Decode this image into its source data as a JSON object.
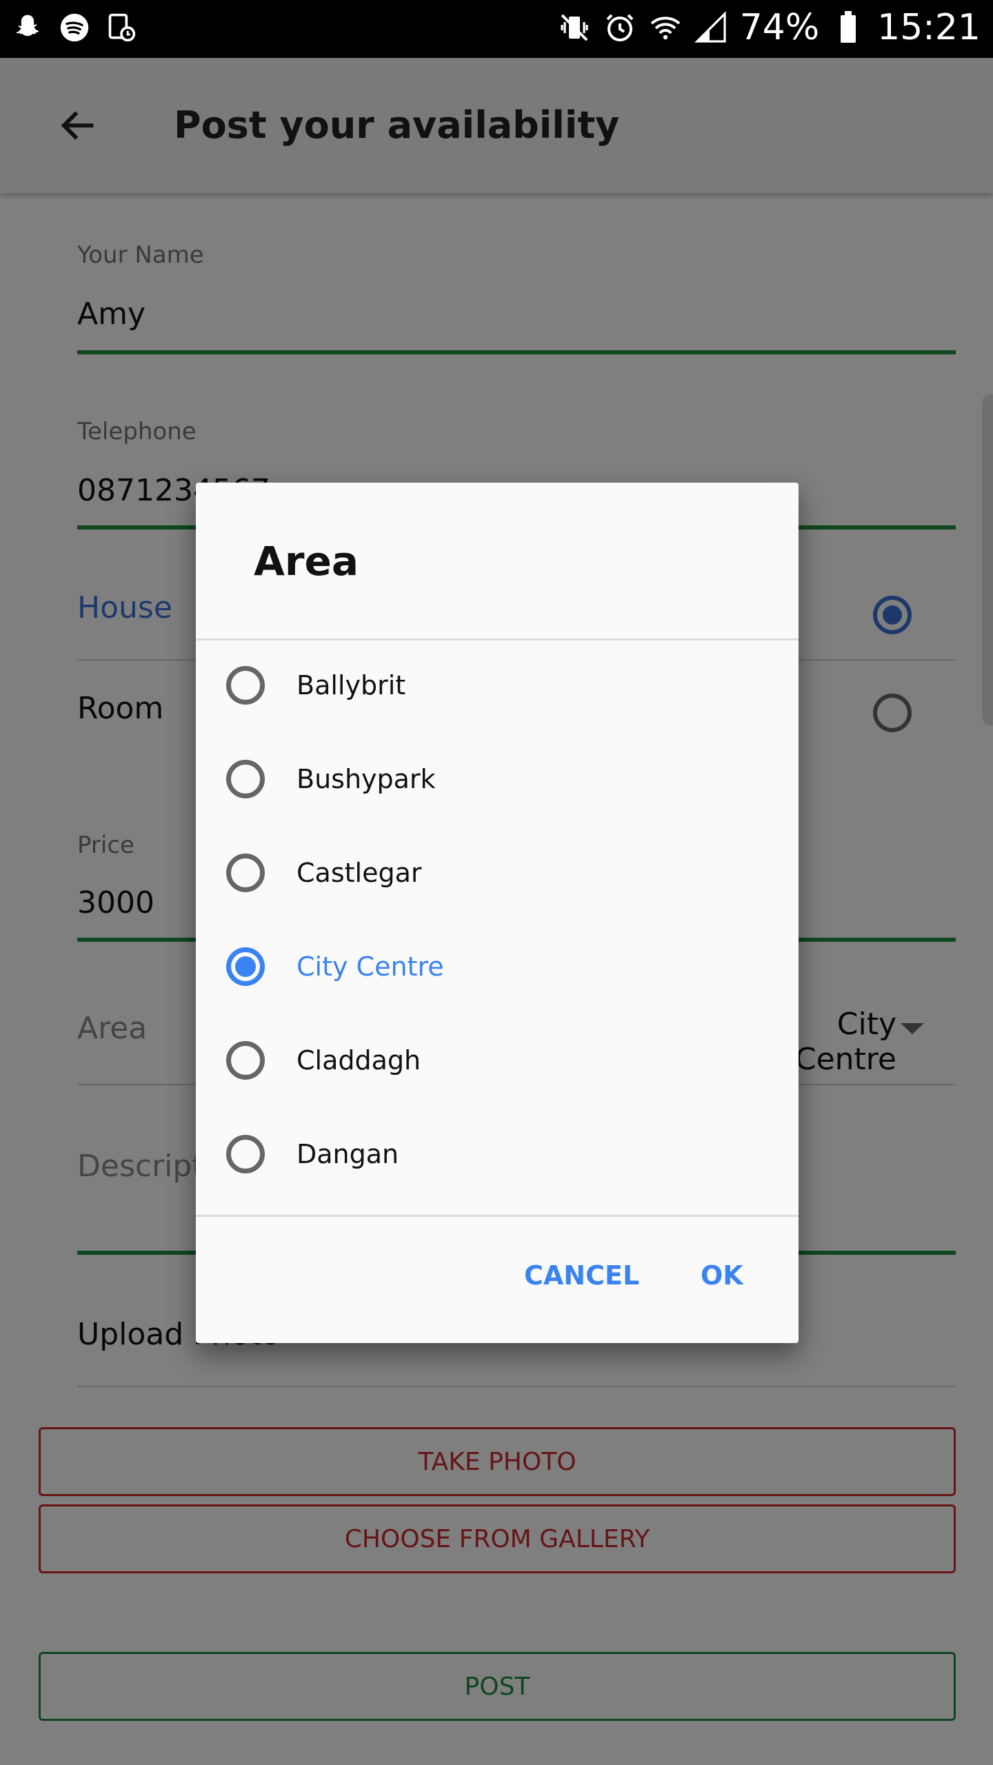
{
  "status_bar": {
    "battery": "74%",
    "time": "15:21",
    "left_icons": [
      "snapchat-icon",
      "spotify-icon",
      "screen-record-icon"
    ],
    "right_icons": [
      "vibrate-mute-icon",
      "alarm-icon",
      "wifi-icon",
      "signal-icon",
      "battery-icon"
    ]
  },
  "app_bar": {
    "title": "Post your availability"
  },
  "form": {
    "name_label": "Your Name",
    "name_value": "Amy",
    "telephone_label": "Telephone",
    "telephone_value": "0871234567",
    "type_house": "House",
    "type_room": "Room",
    "price_label": "Price",
    "price_value": "3000",
    "area_label": "Area",
    "area_value": "City Centre",
    "description_label": "Description",
    "upload_label": "Upload Photo",
    "take_photo": "TAKE PHOTO",
    "choose_gallery": "CHOOSE FROM GALLERY",
    "post": "POST"
  },
  "dialog": {
    "title": "Area",
    "options": [
      "Ballybrit",
      "Bushypark",
      "Castlegar",
      "City Centre",
      "Claddagh",
      "Dangan"
    ],
    "selected": "City Centre",
    "cancel": "CANCEL",
    "ok": "OK"
  },
  "colors": {
    "accent_blue": "#3a83f0",
    "green_underline": "#1e8e3e",
    "red_button": "#cc2b2b"
  }
}
